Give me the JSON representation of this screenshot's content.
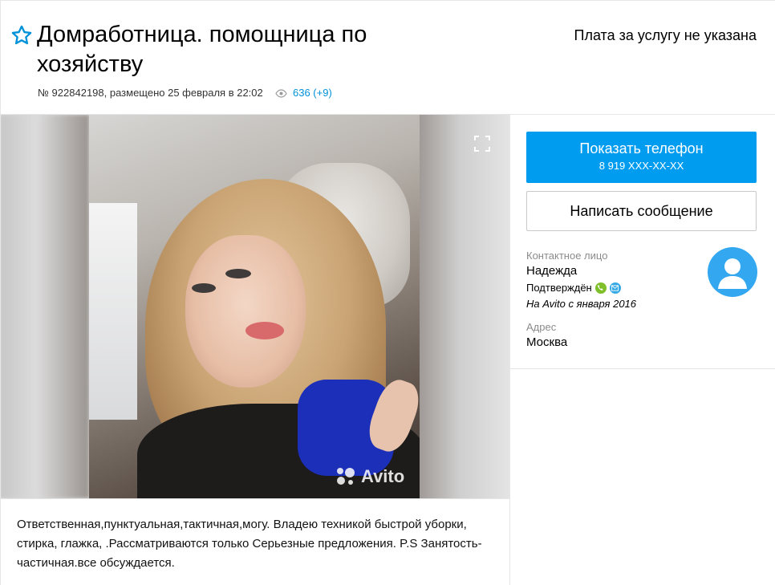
{
  "header": {
    "title": "Домработница. помощница по хозяйству",
    "price": "Плата за услугу не указана",
    "meta": "№ 922842198, размещено 25 февраля в 22:02",
    "views": "636 (+9)"
  },
  "gallery": {
    "watermark": "Avito"
  },
  "description": "Ответственная,пунктуальная,тактичная,могу. Владею техникой быстрой уборки, стирка, глажка, .Рассматриваются только Серьезные предложения. P.S Занятость-частичная.все обсуждается.",
  "sidebar": {
    "show_phone": "Показать телефон",
    "phone_masked": "8 919 XXX-XX-XX",
    "write_message": "Написать сообщение",
    "contact_label": "Контактное лицо",
    "contact_name": "Надежда",
    "verified": "Подтверждён",
    "since": "На Avito с января 2016",
    "address_label": "Адрес",
    "address_value": "Москва"
  },
  "icons": {
    "favorite": "star-outline-icon",
    "views": "eye-icon",
    "fullscreen": "fullscreen-icon",
    "verified_phone": "phone-verified-icon",
    "verified_email": "email-verified-icon",
    "avatar": "user-avatar-icon"
  },
  "colors": {
    "accent": "#009cf0",
    "link": "#0091d9",
    "phone_badge": "#7fbf2a",
    "email_badge": "#35a9e6"
  }
}
